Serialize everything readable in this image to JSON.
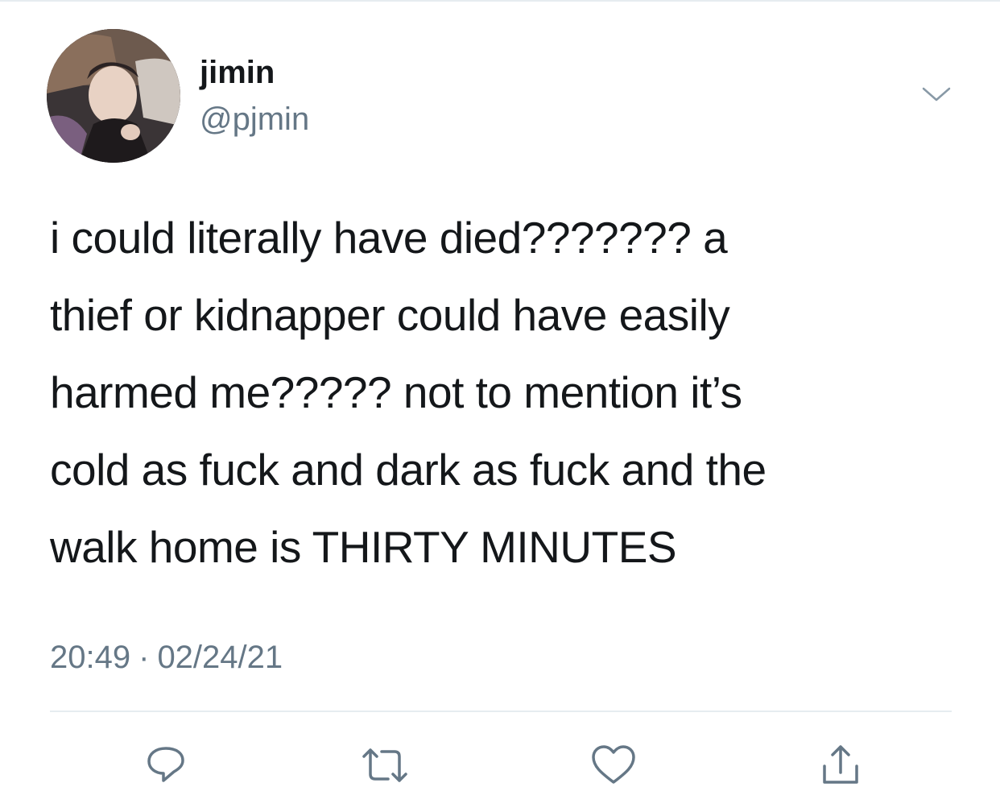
{
  "author": {
    "display_name": "jimin",
    "handle": "@pjmin",
    "avatar": "profile-photo"
  },
  "tweet": {
    "text": "i could literally have died??????? a\nthief or kidnapper could have easily\nharmed me????? not to mention it’s\ncold as fuck and dark as fuck and the\nwalk home is THIRTY MINUTES",
    "time": "20:49",
    "separator": "·",
    "date": "02/24/21"
  },
  "actions": [
    {
      "name": "reply",
      "icon": "reply-icon"
    },
    {
      "name": "retweet",
      "icon": "retweet-icon"
    },
    {
      "name": "like",
      "icon": "heart-icon"
    },
    {
      "name": "share",
      "icon": "share-icon"
    }
  ],
  "colors": {
    "text": "#14171a",
    "secondary": "#657786",
    "divider": "#e6ecf0"
  }
}
